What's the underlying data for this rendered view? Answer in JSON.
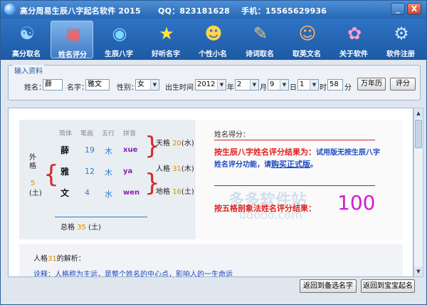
{
  "window": {
    "title": "高分周易生辰八字起名软件 2015",
    "qq": "QQ：823181628",
    "phone": "手机：15565629936",
    "minimize": "_",
    "close": "X"
  },
  "toolbar": {
    "items": [
      {
        "label": "高分取名",
        "icon": "☯"
      },
      {
        "label": "姓名评分",
        "icon": "▦"
      },
      {
        "label": "生辰八字",
        "icon": "◉"
      },
      {
        "label": "好听名字",
        "icon": "★"
      },
      {
        "label": "个性小名",
        "icon": "☻"
      },
      {
        "label": "诗词取名",
        "icon": "✎"
      },
      {
        "label": "取英文名",
        "icon": "☺"
      },
      {
        "label": "关于软件",
        "icon": "✿"
      },
      {
        "label": "软件注册",
        "icon": "⚙"
      }
    ]
  },
  "input": {
    "group_title": "输入资料",
    "surname_label": "姓名：",
    "surname_value": "薛",
    "given_label": "名字：",
    "given_value": "雅文",
    "gender_label": "性别：",
    "gender_value": "女",
    "birth_label": "出生时间：",
    "year_value": "2012",
    "year_unit": "年",
    "month_value": "2",
    "month_unit": "月",
    "day_value": "9",
    "day_unit": "日",
    "hour_value": "1",
    "hour_unit": "时",
    "minute_value": "58",
    "minute_unit": "分",
    "calendar_button": "万年历",
    "score_button": "评分"
  },
  "chart_data": {
    "type": "table",
    "headers": [
      "简体",
      "笔画",
      "五行",
      "拼音"
    ],
    "rows": [
      {
        "char": "薛",
        "strokes": "19",
        "element": "木",
        "pinyin": "xue"
      },
      {
        "char": "雅",
        "strokes": "12",
        "element": "木",
        "pinyin": "ya"
      },
      {
        "char": "文",
        "strokes": "4",
        "element": "水",
        "pinyin": "wen"
      }
    ],
    "wai_ge": {
      "label": "外格",
      "value": "5",
      "element": "(土)"
    },
    "tian_ge": {
      "label": "天格",
      "value": "20",
      "element": "(水)"
    },
    "ren_ge": {
      "label": "人格",
      "value": "31",
      "element": "(木)"
    },
    "di_ge": {
      "label": "地格",
      "value": "16",
      "element": "(土)"
    },
    "zong_ge": {
      "label": "总格",
      "value": "35",
      "element": "(土)"
    }
  },
  "score": {
    "title": "姓名得分：",
    "result1_red": "按生辰八字姓名评分结果为：",
    "result1_blue": "试用版无按生辰八字姓名评分功能，请",
    "buy_link": "购买正式版",
    "result1_end": "。",
    "result2": "按五格剖象法姓名评分结果：",
    "value": "100"
  },
  "watermark": {
    "main": "多多软件站",
    "sub": "ddooo.com"
  },
  "analysis": {
    "title_prefix": "人格",
    "title_value": "31",
    "title_suffix": "的解析：",
    "text": "诠释：人格称为主运，是整个姓名的中心点，影响人的一生命运"
  },
  "buttons": {
    "back_select": "返回到备选名字",
    "back_baby": "返回到宝宝起名"
  }
}
